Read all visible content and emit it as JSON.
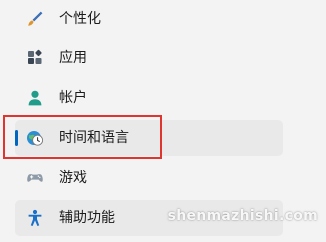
{
  "colors": {
    "background": "#f3f3f3",
    "selected_bg": "#e9e9e9",
    "accent": "#0067c0",
    "highlight_border": "#e0342e"
  },
  "sidebar": {
    "items": [
      {
        "label": "个性化",
        "icon": "brush-icon",
        "state": "normal"
      },
      {
        "label": "应用",
        "icon": "apps-icon",
        "state": "normal"
      },
      {
        "label": "帐户",
        "icon": "person-icon",
        "state": "normal"
      },
      {
        "label": "时间和语言",
        "icon": "globe-clock-icon",
        "state": "selected"
      },
      {
        "label": "游戏",
        "icon": "gamepad-icon",
        "state": "normal"
      },
      {
        "label": "辅助功能",
        "icon": "accessibility-icon",
        "state": "hovered"
      }
    ]
  },
  "annotation": {
    "highlight": "red box around selected item"
  },
  "watermark": {
    "text": "shenmazhishi.com"
  }
}
